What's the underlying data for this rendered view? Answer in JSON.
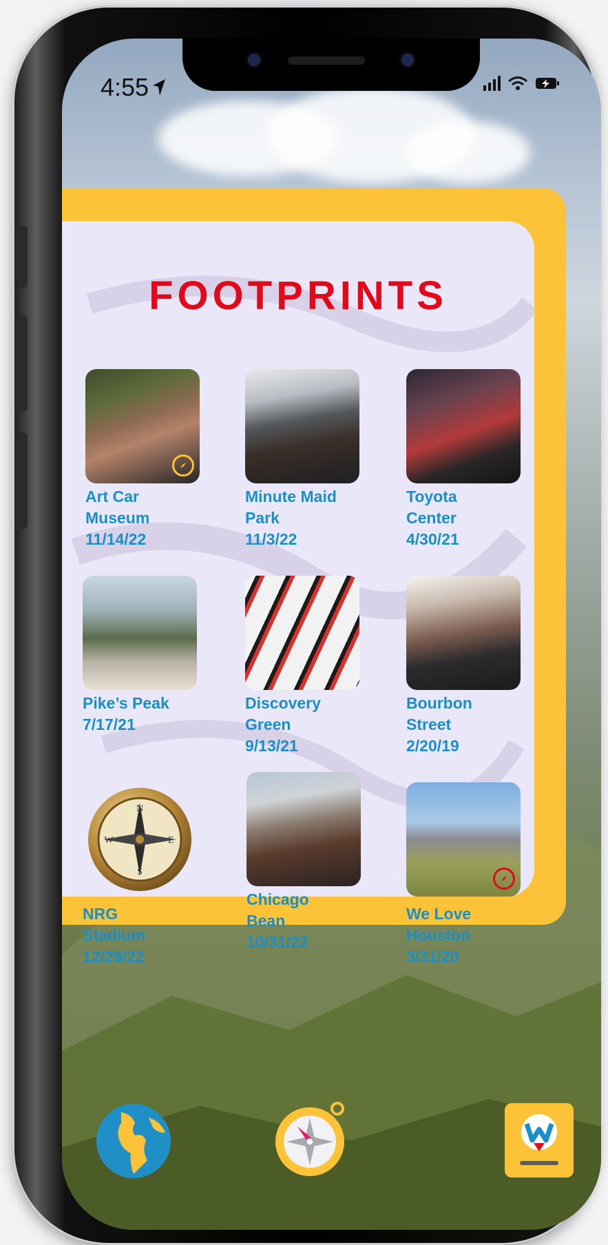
{
  "status": {
    "time": "4:55"
  },
  "header": {
    "title": "FOOTPRINTS"
  },
  "places": [
    {
      "name_lines": [
        "Art Car",
        "Museum"
      ],
      "date": "11/14/22",
      "badge": "compass-badge-icon",
      "badge_color": "#fdc338"
    },
    {
      "name_lines": [
        "Minute Maid",
        "Park"
      ],
      "date": "11/3/22"
    },
    {
      "name_lines": [
        "Toyota",
        "Center"
      ],
      "date": "4/30/21"
    },
    {
      "name_lines": [
        "Pike’s Peak"
      ],
      "date": "7/17/21"
    },
    {
      "name_lines": [
        "Discovery",
        "Green"
      ],
      "date": "9/13/21"
    },
    {
      "name_lines": [
        "Bourbon",
        "Street"
      ],
      "date": "2/20/19"
    },
    {
      "name_lines": [
        "NRG",
        "Stadium"
      ],
      "date": "12/29/22",
      "image": "compass-icon"
    },
    {
      "name_lines": [
        "Chicago",
        "Bean"
      ],
      "date": "10/31/22"
    },
    {
      "name_lines": [
        "We Love",
        "Houston"
      ],
      "date": "3/31/20",
      "badge": "compass-badge-icon",
      "badge_color": "#e2091a"
    }
  ],
  "dock": [
    {
      "icon": "globe-icon"
    },
    {
      "icon": "compass-icon"
    },
    {
      "icon": "wayfinder-app-icon"
    }
  ],
  "colors": {
    "title": "#e2091a",
    "label": "#1a8fc7",
    "card_border": "#fdc338",
    "card_fill": "#eae8f8"
  }
}
